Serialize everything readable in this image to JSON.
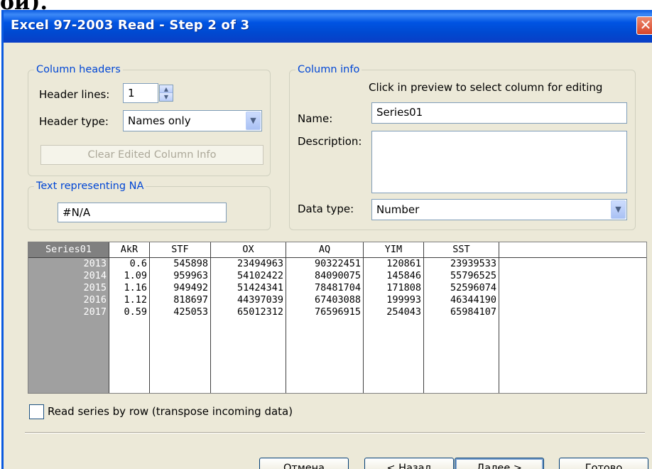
{
  "fragment_text": "ои).",
  "window": {
    "title": "Excel 97-2003 Read - Step 2 of 3",
    "close_glyph": "✕"
  },
  "column_headers": {
    "legend": "Column headers",
    "header_lines_label": "Header lines:",
    "header_lines_value": "1",
    "header_type_label": "Header type:",
    "header_type_value": "Names only",
    "clear_button": "Clear Edited Column Info"
  },
  "na_group": {
    "legend": "Text representing NA",
    "value": "#N/A"
  },
  "column_info": {
    "legend": "Column info",
    "hint": "Click in preview to select column for editing",
    "name_label": "Name:",
    "name_value": "Series01",
    "description_label": "Description:",
    "description_value": "",
    "data_type_label": "Data type:",
    "data_type_value": "Number"
  },
  "preview": {
    "columns": [
      "Series01",
      "AkR",
      "STF",
      "OX",
      "AQ",
      "YIM",
      "SST"
    ],
    "rows": [
      [
        "2013",
        "0.6",
        "545898",
        "23494963",
        "90322451",
        "120861",
        "23939533"
      ],
      [
        "2014",
        "1.09",
        "959963",
        "54102422",
        "84090075",
        "145846",
        "55796525"
      ],
      [
        "2015",
        "1.16",
        "949492",
        "51424341",
        "78481704",
        "171808",
        "52596074"
      ],
      [
        "2016",
        "1.12",
        "818697",
        "44397039",
        "67403088",
        "199993",
        "46344190"
      ],
      [
        "2017",
        "0.59",
        "425053",
        "65012312",
        "76596915",
        "254043",
        "65984107"
      ]
    ]
  },
  "transpose_checkbox": {
    "label": "Read series by row (transpose incoming data)",
    "checked": false
  },
  "buttons": {
    "cancel": "Отмена",
    "back": "< Назад",
    "next": "Далее >",
    "finish": "Готово"
  },
  "colors": {
    "titlebar": "#0054e3",
    "dialog_bg": "#ece9d8",
    "group_legend": "#0046d5",
    "selected_column": "#808080"
  }
}
